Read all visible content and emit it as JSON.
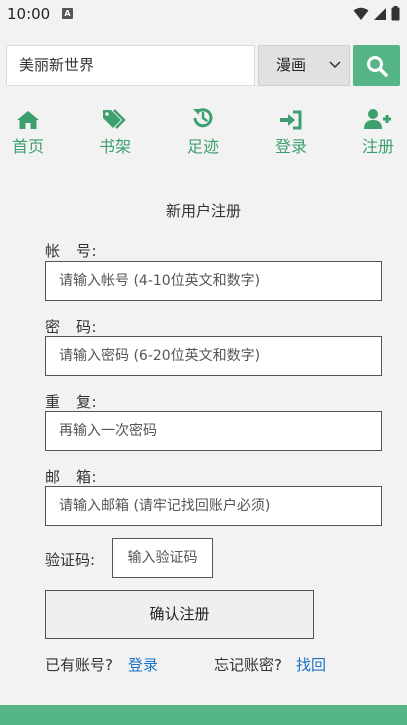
{
  "status_bar": {
    "time": "10:00",
    "badge": "A"
  },
  "search": {
    "value": "美丽新世界",
    "category": "漫画"
  },
  "nav": [
    {
      "label": "首页",
      "icon": "home-icon"
    },
    {
      "label": "书架",
      "icon": "tags-icon"
    },
    {
      "label": "足迹",
      "icon": "history-icon"
    },
    {
      "label": "登录",
      "icon": "sign-in-icon"
    },
    {
      "label": "注册",
      "icon": "user-plus-icon"
    }
  ],
  "form": {
    "title": "新用户注册",
    "account_label": "帐　号:",
    "account_placeholder": "请输入帐号 (4-10位英文和数字)",
    "password_label": "密　码:",
    "password_placeholder": "请输入密码 (6-20位英文和数字)",
    "repeat_label": "重　复:",
    "repeat_placeholder": "再输入一次密码",
    "email_label": "邮　箱:",
    "email_placeholder": "请输入邮箱 (请牢记找回账户必须)",
    "captcha_label": "验证码:",
    "captcha_placeholder": "输入验证码",
    "submit_label": "确认注册"
  },
  "links": {
    "have_account": "已有账号?",
    "login": "登录",
    "forgot": "忘记账密?",
    "recover": "找回"
  },
  "colors": {
    "accent": "#55b586",
    "nav_text": "#3fa06f",
    "link": "#1a73c9"
  }
}
